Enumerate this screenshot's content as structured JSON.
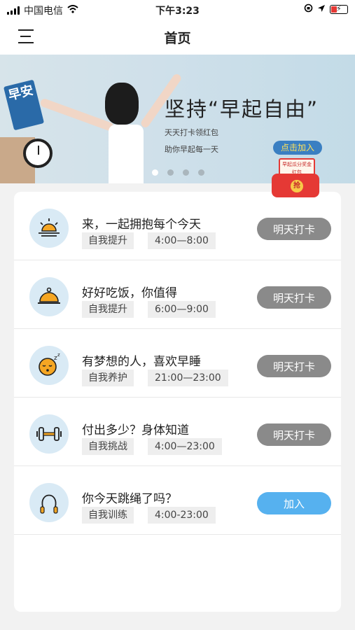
{
  "status_bar": {
    "carrier": "中国电信",
    "time": "下午3:23",
    "battery_color": "#e53935"
  },
  "header": {
    "title": "首页",
    "menu_icon": "menu-icon"
  },
  "banner": {
    "headline": "坚持“早起自由”",
    "line1": "天天打卡领红包",
    "line2": "助你早起每一天",
    "cta": "点击加入",
    "sign_text": "早安",
    "active_slide": 1,
    "slide_count": 4,
    "red_packet": {
      "card_text": "早起瓜分奖金红包",
      "coin_text": "抢"
    }
  },
  "tasks": [
    {
      "icon": "sunrise-icon",
      "title": "来，一起拥抱每个今天",
      "tag": "自我提升",
      "time": "4:00—8:00",
      "action": "明天打卡",
      "action_type": "checkin"
    },
    {
      "icon": "food-cloche-icon",
      "title": "好好吃饭，你值得",
      "tag": "自我提升",
      "time": "6:00—9:00",
      "action": "明天打卡",
      "action_type": "checkin"
    },
    {
      "icon": "sleeping-face-icon",
      "title": "有梦想的人，喜欢早睡",
      "tag": "自我养护",
      "time": "21:00—23:00",
      "action": "明天打卡",
      "action_type": "checkin"
    },
    {
      "icon": "dumbbell-icon",
      "title": "付出多少？身体知道",
      "tag": "自我挑战",
      "time": "4:00—23:00",
      "action": "明天打卡",
      "action_type": "checkin"
    },
    {
      "icon": "jump-rope-icon",
      "title": "你今天跳绳了吗？",
      "tag": "自我训练",
      "time": "4:00-23:00",
      "action": "加入",
      "action_type": "join"
    }
  ],
  "colors": {
    "checkin_button": "#8a8a8a",
    "join_button": "#56b1ef",
    "icon_bg": "#d9eaf5",
    "accent_orange": "#f5a623"
  }
}
